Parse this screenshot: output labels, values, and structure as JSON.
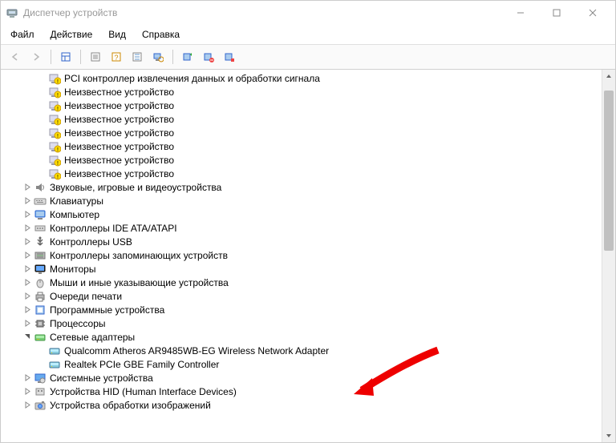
{
  "window": {
    "title": "Диспетчер устройств"
  },
  "menus": {
    "file": "Файл",
    "action": "Действие",
    "view": "Вид",
    "help": "Справка"
  },
  "tree": {
    "warn_items": [
      "PCI контроллер извлечения данных и обработки сигнала",
      "Неизвестное устройство",
      "Неизвестное устройство",
      "Неизвестное устройство",
      "Неизвестное устройство",
      "Неизвестное устройство",
      "Неизвестное устройство",
      "Неизвестное устройство"
    ],
    "categories": [
      {
        "label": "Звуковые, игровые и видеоустройства",
        "icon": "speaker"
      },
      {
        "label": "Клавиатуры",
        "icon": "keyboard"
      },
      {
        "label": "Компьютер",
        "icon": "computer"
      },
      {
        "label": "Контроллеры IDE ATA/ATAPI",
        "icon": "ide"
      },
      {
        "label": "Контроллеры USB",
        "icon": "usb"
      },
      {
        "label": "Контроллеры запоминающих устройств",
        "icon": "storage"
      },
      {
        "label": "Мониторы",
        "icon": "monitor"
      },
      {
        "label": "Мыши и иные указывающие устройства",
        "icon": "mouse"
      },
      {
        "label": "Очереди печати",
        "icon": "printer"
      },
      {
        "label": "Программные устройства",
        "icon": "software"
      },
      {
        "label": "Процессоры",
        "icon": "cpu"
      },
      {
        "label": "Сетевые адаптеры",
        "icon": "network",
        "expanded": true,
        "children": [
          "Qualcomm Atheros AR9485WB-EG Wireless Network Adapter",
          "Realtek PCIe GBE Family Controller"
        ]
      },
      {
        "label": "Системные устройства",
        "icon": "system"
      },
      {
        "label": "Устройства HID (Human Interface Devices)",
        "icon": "hid"
      },
      {
        "label": "Устройства обработки изображений",
        "icon": "imaging"
      }
    ]
  }
}
